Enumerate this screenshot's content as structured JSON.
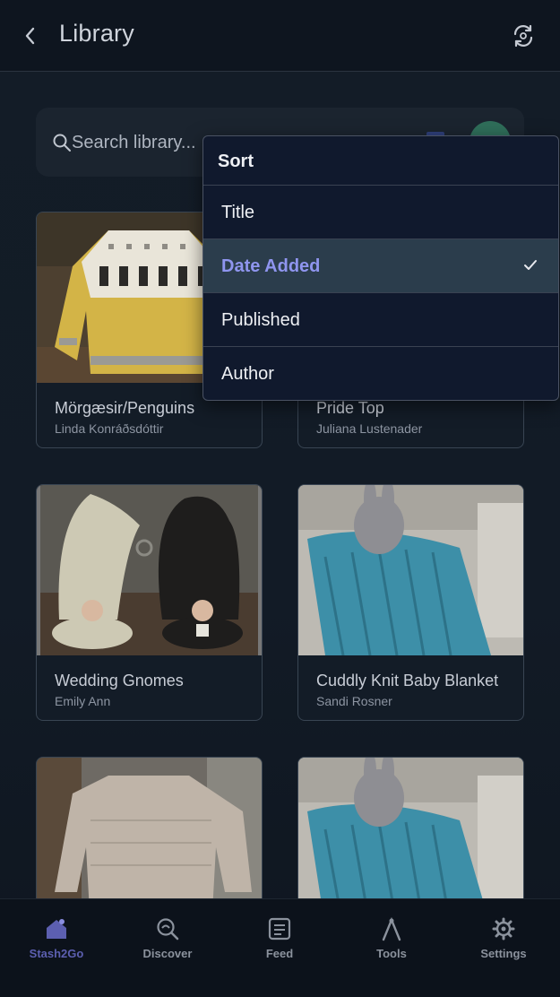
{
  "header": {
    "title": "Library",
    "back_icon": "chevron-left-icon",
    "sync_icon": "sync-icon"
  },
  "search": {
    "placeholder": "Search library..."
  },
  "patterns": [
    {
      "title": "Mörgæsir/Penguins",
      "author": "Linda Konráðsdóttir"
    },
    {
      "title": "Pride Top",
      "author": "Juliana Lustenader"
    },
    {
      "title": "Wedding Gnomes",
      "author": "Emily Ann"
    },
    {
      "title": "Cuddly Knit Baby Blanket",
      "author": "Sandi Rosner"
    },
    {
      "title": "",
      "author": ""
    },
    {
      "title": "",
      "author": ""
    }
  ],
  "sort_menu": {
    "header": "Sort",
    "options": [
      {
        "label": "Title",
        "selected": false
      },
      {
        "label": "Date Added",
        "selected": true
      },
      {
        "label": "Published",
        "selected": false
      },
      {
        "label": "Author",
        "selected": false
      }
    ]
  },
  "bottom_nav": [
    {
      "label": "Stash2Go",
      "icon": "home-icon",
      "active": true
    },
    {
      "label": "Discover",
      "icon": "discover-icon",
      "active": false
    },
    {
      "label": "Feed",
      "icon": "feed-icon",
      "active": false
    },
    {
      "label": "Tools",
      "icon": "tools-icon",
      "active": false
    },
    {
      "label": "Settings",
      "icon": "settings-icon",
      "active": false
    }
  ],
  "colors": {
    "accent": "#8f95ef",
    "active_nav": "#5c5fb0",
    "menu_bg": "#10192d",
    "selected_bg": "#2b3d4c"
  }
}
